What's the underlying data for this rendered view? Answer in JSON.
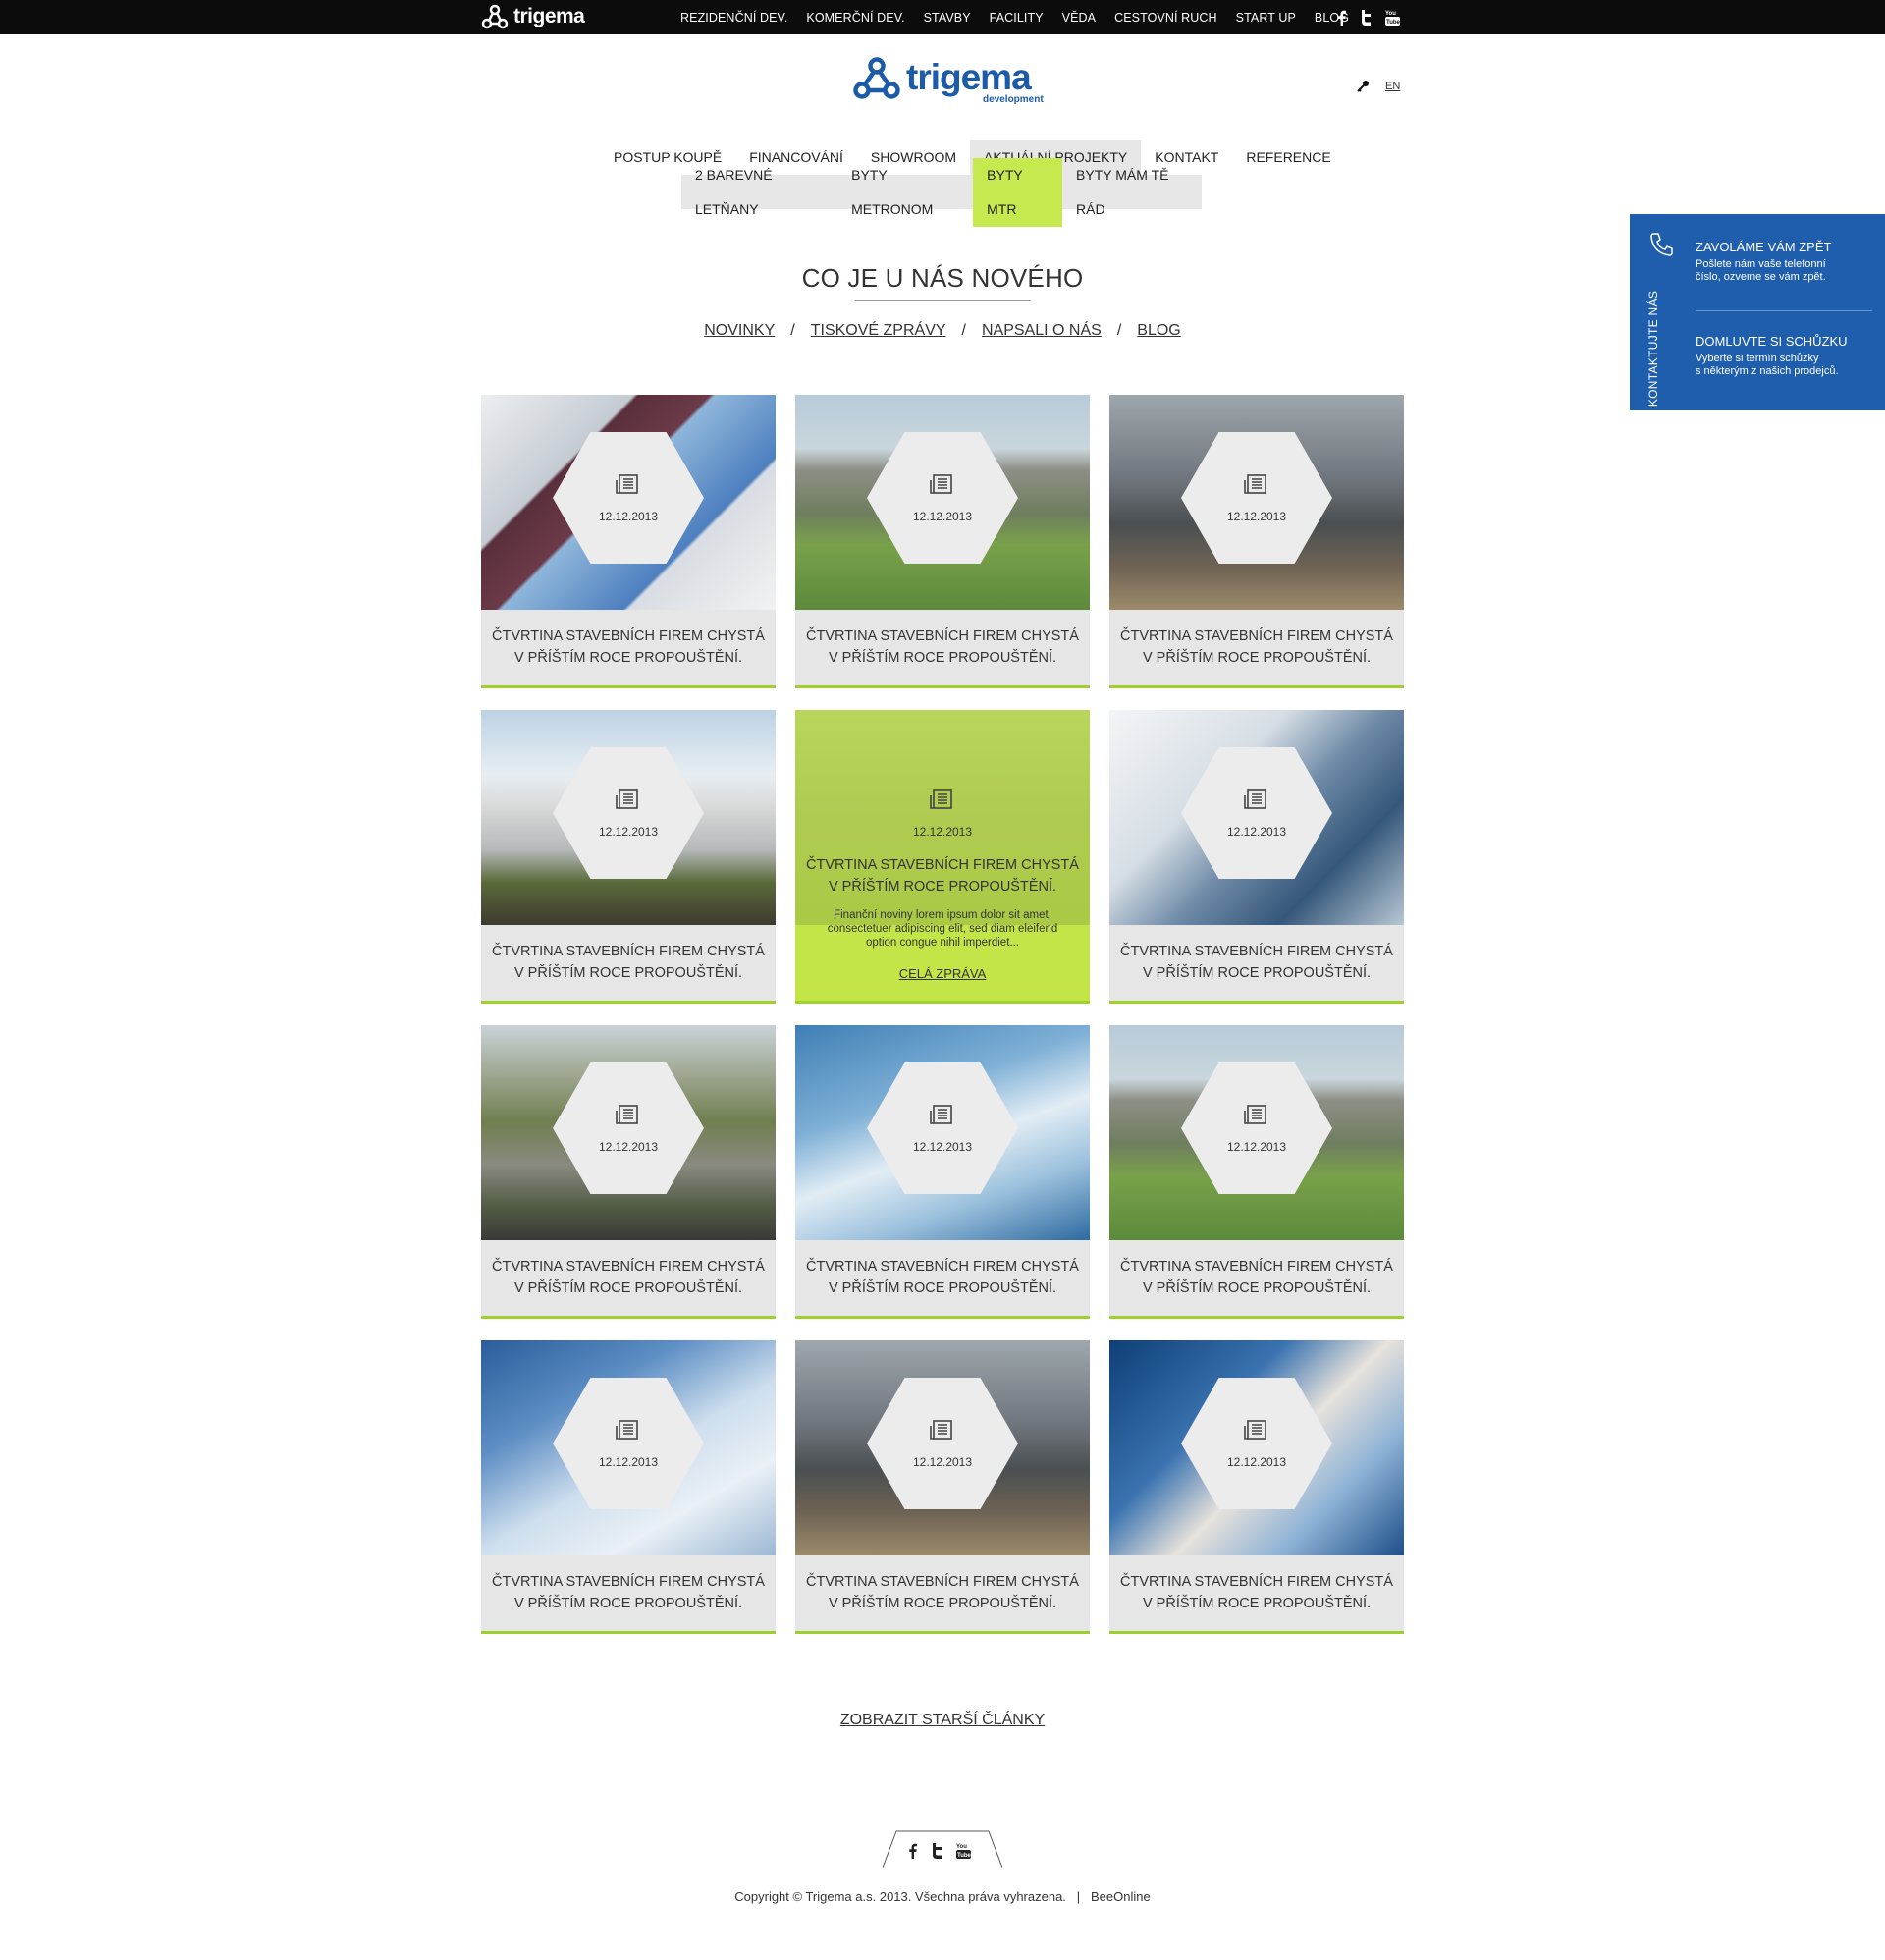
{
  "topbar": {
    "brand": "trigema",
    "nav": [
      "REZIDENČNÍ DEV.",
      "KOMERČNÍ DEV.",
      "STAVBY",
      "FACILITY",
      "VĚDA",
      "CESTOVNÍ RUCH",
      "START UP",
      "BLOG"
    ]
  },
  "logo": {
    "brand": "trigema",
    "sub": "development"
  },
  "util": {
    "lang": "EN"
  },
  "mainnav": [
    "POSTUP KOUPĚ",
    "FINANCOVÁNÍ",
    "SHOWROOM",
    "AKTUÁLNÍ PROJEKTY",
    "KONTAKT",
    "REFERENCE"
  ],
  "subnav": [
    "2 BAREVNÉ LETŇANY",
    "BYTY METRONOM",
    "BYTY MTR",
    "BYTY MÁM TĚ RÁD"
  ],
  "section": {
    "title": "CO JE U NÁS NOVÉHO"
  },
  "filters": [
    "NOVINKY",
    "TISKOVÉ ZPRÁVY",
    "NAPSALI O NÁS",
    "BLOG"
  ],
  "cards": [
    {
      "date": "12.12.2013",
      "title_l1": "ČTVRTINA STAVEBNÍCH FIREM CHYSTÁ",
      "title_l2": "V PŘÍŠTÍM ROCE PROPOUŠTĚNÍ."
    },
    {
      "date": "12.12.2013",
      "title_l1": "ČTVRTINA STAVEBNÍCH FIREM CHYSTÁ",
      "title_l2": "V PŘÍŠTÍM ROCE PROPOUŠTĚNÍ."
    },
    {
      "date": "12.12.2013",
      "title_l1": "ČTVRTINA STAVEBNÍCH FIREM CHYSTÁ",
      "title_l2": "V PŘÍŠTÍM ROCE PROPOUŠTĚNÍ."
    },
    {
      "date": "12.12.2013",
      "title_l1": "ČTVRTINA STAVEBNÍCH FIREM CHYSTÁ",
      "title_l2": "V PŘÍŠTÍM ROCE PROPOUŠTĚNÍ."
    },
    {
      "date": "12.12.2013",
      "title_l1": "ČTVRTINA STAVEBNÍCH FIREM CHYSTÁ",
      "title_l2": "V PŘÍŠTÍM ROCE PROPOUŠTĚNÍ.",
      "excerpt": "Finanční noviny lorem ipsum dolor sit amet, consectetuer adipiscing elit, sed diam eleifend option congue nihil imperdiet...",
      "more": "CELÁ ZPRÁVA"
    },
    {
      "date": "12.12.2013",
      "title_l1": "ČTVRTINA STAVEBNÍCH FIREM CHYSTÁ",
      "title_l2": "V PŘÍŠTÍM ROCE PROPOUŠTĚNÍ."
    },
    {
      "date": "12.12.2013",
      "title_l1": "ČTVRTINA STAVEBNÍCH FIREM CHYSTÁ",
      "title_l2": "V PŘÍŠTÍM ROCE PROPOUŠTĚNÍ."
    },
    {
      "date": "12.12.2013",
      "title_l1": "ČTVRTINA STAVEBNÍCH FIREM CHYSTÁ",
      "title_l2": "V PŘÍŠTÍM ROCE PROPOUŠTĚNÍ."
    },
    {
      "date": "12.12.2013",
      "title_l1": "ČTVRTINA STAVEBNÍCH FIREM CHYSTÁ",
      "title_l2": "V PŘÍŠTÍM ROCE PROPOUŠTĚNÍ."
    },
    {
      "date": "12.12.2013",
      "title_l1": "ČTVRTINA STAVEBNÍCH FIREM CHYSTÁ",
      "title_l2": "V PŘÍŠTÍM ROCE PROPOUŠTĚNÍ."
    },
    {
      "date": "12.12.2013",
      "title_l1": "ČTVRTINA STAVEBNÍCH FIREM CHYSTÁ",
      "title_l2": "V PŘÍŠTÍM ROCE PROPOUŠTĚNÍ."
    },
    {
      "date": "12.12.2013",
      "title_l1": "ČTVRTINA STAVEBNÍCH FIREM CHYSTÁ",
      "title_l2": "V PŘÍŠTÍM ROCE PROPOUŠTĚNÍ."
    }
  ],
  "older": "ZOBRAZIT STARŠÍ ČLÁNKY",
  "footer": {
    "copyright": "Copyright © Trigema a.s. 2013. Všechna práva vyhrazena.",
    "separator": "|",
    "credit": "BeeOnline"
  },
  "contact": {
    "tab": "KONTAKTUJTE NÁS",
    "call_title": "ZAVOLÁME VÁM ZPĚT",
    "call_text_l1": "Pošlete nám vaše telefonní",
    "call_text_l2": "číslo, ozveme se vám zpět.",
    "meet_title": "DOMLUVTE SI SCHŮZKU",
    "meet_text_l1": "Vyberte si termín schůzky",
    "meet_text_l2": "s některým z našich prodejců."
  },
  "colors": {
    "accent_green": "#c6e94f",
    "underline_green": "#9ed12d",
    "brand_blue": "#1c5ba8",
    "panel_blue": "#1f5eac"
  },
  "icons": [
    "trigema-logo-icon",
    "facebook-icon",
    "twitter-icon",
    "youtube-icon",
    "key-icon",
    "newspaper-icon",
    "phone-icon"
  ]
}
